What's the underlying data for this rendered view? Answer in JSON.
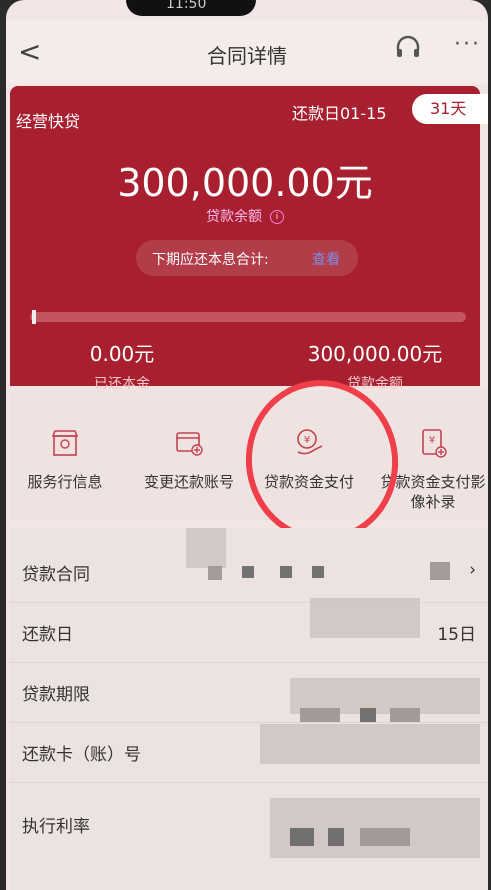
{
  "status_bar": {
    "time": "11:50"
  },
  "header": {
    "title": "合同详情",
    "back": "<",
    "more": "···"
  },
  "hero": {
    "product": "经营快贷",
    "repay_day_label": "还款日01-15",
    "days_pill": "31天",
    "balance": "300,000.00元",
    "balance_label": "贷款余额",
    "next_label": "下期应还本息合计:",
    "next_link": "查看",
    "progress_fraction": 0.0,
    "repaid_value": "0.00元",
    "repaid_label": "已还本金",
    "loan_value": "300,000.00元",
    "loan_label": "贷款金额"
  },
  "quick_actions": [
    {
      "label": "服务行信息",
      "icon": "bank-branch-icon"
    },
    {
      "label": "变更还款账号",
      "icon": "card-edit-icon"
    },
    {
      "label": "贷款资金支付",
      "icon": "yuan-hand-icon"
    },
    {
      "label": "贷款资金支付影像补录",
      "icon": "yuan-document-icon"
    }
  ],
  "details": [
    {
      "key": "贷款合同",
      "value": ""
    },
    {
      "key": "还款日",
      "value": "15日"
    },
    {
      "key": "贷款期限",
      "value": ""
    },
    {
      "key": "还款卡（账）号",
      "value": ""
    },
    {
      "key": "执行利率",
      "value": ""
    }
  ],
  "colors": {
    "brand_red": "#a8202f",
    "annotation_circle": "#ef3f4a"
  }
}
